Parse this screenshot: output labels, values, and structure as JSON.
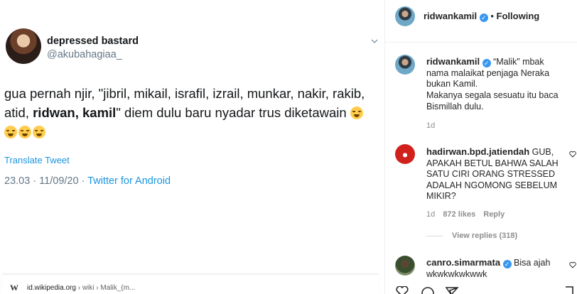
{
  "tweet": {
    "display_name": "depressed bastard",
    "handle": "@akubahagiaa_",
    "text_1": "gua pernah njir, \"jibril, mikail, israfil, izrail, munkar, nakir, rakib, atid, ",
    "text_bold": "ridwan, kamil",
    "text_2": "\" diem dulu baru nyadar trus diketawain",
    "translate_label": "Translate Tweet",
    "timestamp": "23.03 · 11/09/20 · ",
    "source": "Twitter for Android"
  },
  "browser_bar": {
    "logo": "W",
    "domain": "id.wikipedia.org",
    "path": " › wiki › Malik_(m..."
  },
  "instagram": {
    "header": {
      "username": "ridwankamil",
      "separator": " • ",
      "follow_label": "Following"
    },
    "caption": {
      "username": "ridwankamil",
      "text_1": " “Malik” mbak nama malaikat penjaga Neraka bukan Kamil.",
      "text_2": "Makanya segala sesuatu itu baca Bismillah dulu.",
      "time": "1d"
    },
    "comments": [
      {
        "username": "hadirwan.bpd.jatiendah",
        "text": " GUB, APAKAH BETUL BAHWA SALAH SATU CIRI ORANG STRESSED ADALAH NGOMONG SEBELUM MIKIR?",
        "time": "1d",
        "likes": "872 likes",
        "reply": "Reply",
        "view_replies": "View replies (318)"
      },
      {
        "username": "canro.simarmata",
        "text": " Bisa ajah wkwkwkwkwwk"
      }
    ]
  },
  "colors": {
    "link": "#1b95e0",
    "verified": "#3897f0",
    "muted": "#8e8e8e"
  }
}
